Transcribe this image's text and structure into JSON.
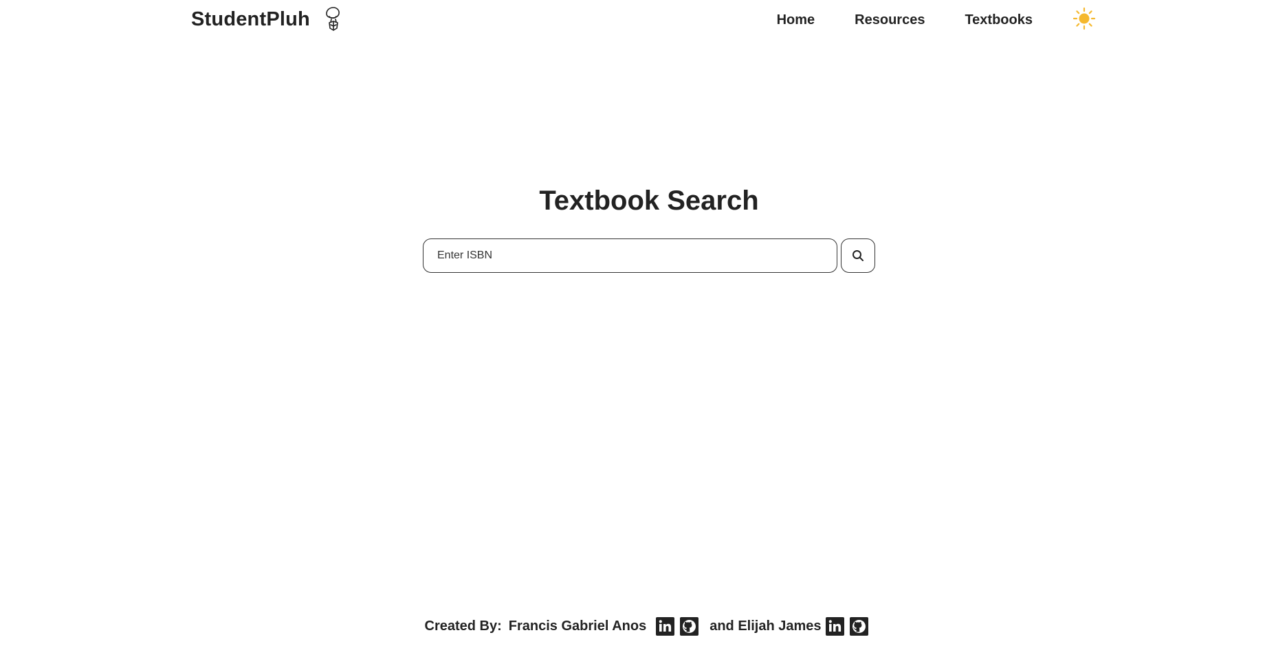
{
  "header": {
    "brand_name": "StudentPluh",
    "logo_icon": "mascot-icon",
    "nav": {
      "home": "Home",
      "resources": "Resources",
      "textbooks": "Textbooks"
    },
    "theme_toggle_icon": "sun-icon",
    "theme_color": "#F5B82E"
  },
  "main": {
    "title": "Textbook Search",
    "search": {
      "placeholder": "Enter ISBN",
      "value": "",
      "button_icon": "search-icon"
    }
  },
  "footer": {
    "label": "Created By:",
    "author1": "Francis Gabriel Anos",
    "connector": "and Elijah James",
    "icons": [
      "linkedin-icon",
      "github-icon"
    ]
  },
  "colors": {
    "text": "#222222",
    "background": "#FFFFFF",
    "border": "#333333"
  }
}
